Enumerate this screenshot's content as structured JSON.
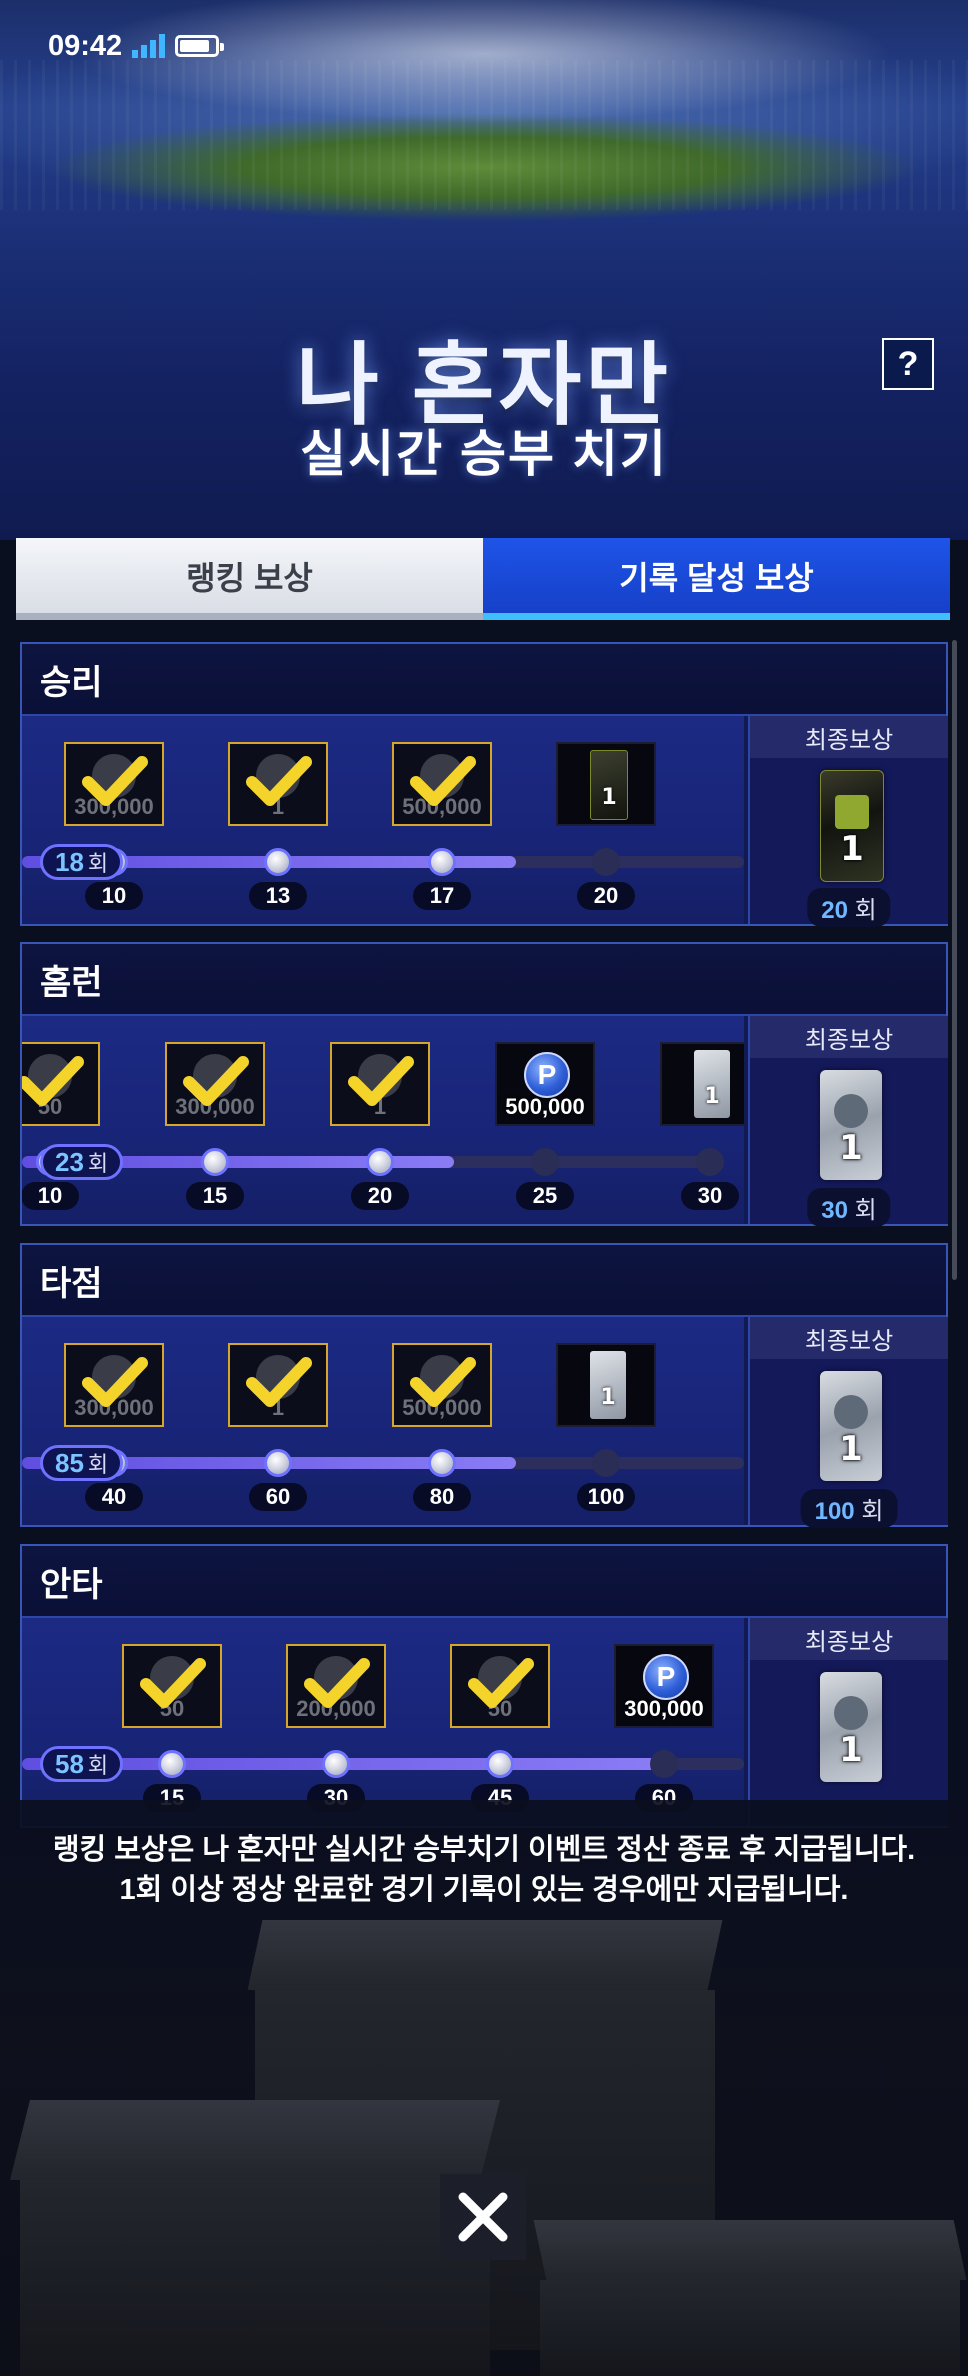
{
  "status_bar": {
    "time": "09:42",
    "battery_level": 0.85
  },
  "header": {
    "title": "나 혼자만",
    "subtitle": "실시간 승부 치기",
    "help_label": "?"
  },
  "tabs": [
    {
      "label": "랭킹 보상",
      "active": false
    },
    {
      "label": "기록 달성 보상",
      "active": true
    }
  ],
  "unit": "회",
  "final_reward_label": "최종보상",
  "categories": [
    {
      "title": "승리",
      "current": "18",
      "progress": 0.85,
      "milestones": [
        {
          "value": "10",
          "reached": true,
          "reward": "points",
          "amount": "300,000",
          "claimed": true
        },
        {
          "value": "13",
          "reached": true,
          "reward": "card",
          "amount": "1",
          "claimed": true
        },
        {
          "value": "17",
          "reached": true,
          "reward": "points",
          "amount": "500,000",
          "claimed": true
        },
        {
          "value": "20",
          "reached": false,
          "reward": "impact-pack",
          "amount": "1",
          "claimed": false
        }
      ],
      "final": {
        "count": "20",
        "item": "impact-pack",
        "amount": "1"
      }
    },
    {
      "title": "홈런",
      "current": "23",
      "progress": 0.64,
      "milestones": [
        {
          "value": "10",
          "reached": true,
          "reward": "card",
          "amount": "50",
          "claimed": true
        },
        {
          "value": "15",
          "reached": true,
          "reward": "points",
          "amount": "300,000",
          "claimed": true
        },
        {
          "value": "20",
          "reached": true,
          "reward": "card",
          "amount": "1",
          "claimed": true
        },
        {
          "value": "25",
          "reached": false,
          "reward": "points",
          "amount": "500,000",
          "claimed": false
        },
        {
          "value": "30",
          "reached": false,
          "reward": "player-pack",
          "amount": "1",
          "claimed": false
        }
      ],
      "final": {
        "count": "30",
        "item": "player-pack",
        "amount": "1"
      }
    },
    {
      "title": "타점",
      "current": "85",
      "progress": 0.83,
      "milestones": [
        {
          "value": "40",
          "reached": true,
          "reward": "points",
          "amount": "300,000",
          "claimed": true
        },
        {
          "value": "60",
          "reached": true,
          "reward": "card",
          "amount": "1",
          "claimed": true
        },
        {
          "value": "80",
          "reached": true,
          "reward": "points",
          "amount": "500,000",
          "claimed": true
        },
        {
          "value": "100",
          "reached": false,
          "reward": "skill-change",
          "amount": "1",
          "claimed": false
        }
      ],
      "final": {
        "count": "100",
        "item": "skill-change",
        "amount": "1"
      }
    },
    {
      "title": "안타",
      "current": "58",
      "progress": 0.95,
      "milestones": [
        {
          "value": "15",
          "reached": true,
          "reward": "card",
          "amount": "50",
          "claimed": true
        },
        {
          "value": "30",
          "reached": true,
          "reward": "points",
          "amount": "200,000",
          "claimed": true
        },
        {
          "value": "45",
          "reached": true,
          "reward": "card",
          "amount": "50",
          "claimed": true
        },
        {
          "value": "60",
          "reached": false,
          "reward": "points",
          "amount": "300,000",
          "claimed": false
        }
      ],
      "final": {
        "count": "",
        "item": "potential-reset",
        "amount": "1"
      }
    }
  ],
  "notice": {
    "line1": "랭킹 보상은 나 혼자만 실시간 승부치기 이벤트 정산 종료 후 지급됩니다.",
    "line2": "1회 이상 정상 완료한 경기 기록이 있는 경우에만 지급됩니다."
  },
  "close_label": "close",
  "colors": {
    "tab_active": "#1e54e8",
    "track_fill": "#7263ef",
    "check": "#f4d32b",
    "count_text": "#6fb8ff"
  }
}
